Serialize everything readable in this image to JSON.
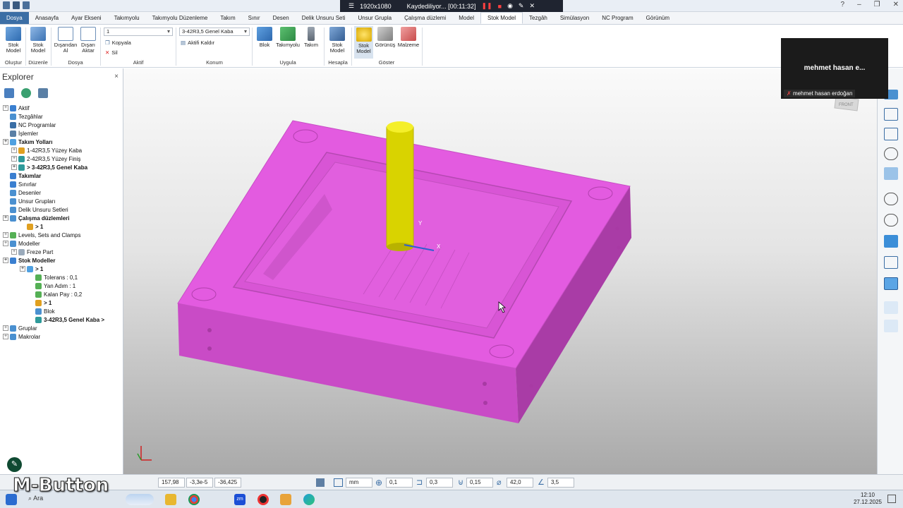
{
  "titlebar": {
    "resolution": "1920x1080",
    "recording": "Kaydediliyor... [00:11:32]"
  },
  "tabs": [
    "Dosya",
    "Anasayfa",
    "Ayar Ekseni",
    "Takımyolu",
    "Takımyolu Düzenleme",
    "Takım",
    "Sınır",
    "Desen",
    "Delik Unsuru Seti",
    "Unsur Grupla",
    "Çalışma düzlemi",
    "Model",
    "Stok Model",
    "Tezgâh",
    "Simülasyon",
    "NC Program",
    "Görünüm"
  ],
  "ribbon": {
    "olustur": {
      "btn": "Stok Model",
      "group": "Oluştur"
    },
    "duzenle": {
      "btn": "Stok Model",
      "group": "Düzenle"
    },
    "dosya": {
      "btn1": "Dışarıdan Al",
      "btn2": "Dışarı Aktar",
      "group": "Dosya"
    },
    "aktif": {
      "combo": "1",
      "kopyala": "Kopyala",
      "sil": "Sil",
      "group": "Aktif"
    },
    "konum": {
      "combo": "3-42R3,5 Genel Kaba",
      "aktifi_kaldir": "Aktifi Kaldır",
      "group": "Konum"
    },
    "uygula": {
      "blok": "Blok",
      "takimyolu": "Takımyolu",
      "takim": "Takım",
      "group": "Uygula"
    },
    "hesapla": {
      "btn": "Stok Model",
      "group": "Hesapla"
    },
    "goster": {
      "stok": "Stok Model",
      "gorunus": "Görünüş",
      "malzeme": "Malzeme",
      "group": "Göster"
    }
  },
  "explorer": {
    "title": "Explorer",
    "items": [
      {
        "label": "Aktif",
        "bold": false,
        "indent": 0
      },
      {
        "label": "Tezgâhlar",
        "bold": false,
        "indent": 0
      },
      {
        "label": "NC Programlar",
        "bold": false,
        "indent": 0
      },
      {
        "label": "İşlemler",
        "bold": false,
        "indent": 0
      },
      {
        "label": "Takım Yolları",
        "bold": true,
        "indent": 0
      },
      {
        "label": "1-42R3,5 Yüzey Kaba",
        "bold": false,
        "indent": 1
      },
      {
        "label": "2-42R3,5 Yüzey Finiş",
        "bold": false,
        "indent": 1
      },
      {
        "label": "> 3-42R3,5 Genel Kaba",
        "bold": true,
        "indent": 1
      },
      {
        "label": "Takımlar",
        "bold": true,
        "indent": 0
      },
      {
        "label": "Sınırlar",
        "bold": false,
        "indent": 0
      },
      {
        "label": "Desenler",
        "bold": false,
        "indent": 0
      },
      {
        "label": "Unsur Grupları",
        "bold": false,
        "indent": 0
      },
      {
        "label": "Delik Unsuru Setleri",
        "bold": false,
        "indent": 0
      },
      {
        "label": "Çalışma düzlemleri",
        "bold": true,
        "indent": 0
      },
      {
        "label": "> 1",
        "bold": true,
        "indent": 2
      },
      {
        "label": "Levels, Sets and Clamps",
        "bold": false,
        "indent": 0
      },
      {
        "label": "Modeller",
        "bold": false,
        "indent": 0
      },
      {
        "label": "Freze Part",
        "bold": false,
        "indent": 1
      },
      {
        "label": "Stok Modeller",
        "bold": true,
        "indent": 0
      },
      {
        "label": "> 1",
        "bold": true,
        "indent": 2
      },
      {
        "label": "Tolerans  :  0,1",
        "bold": false,
        "indent": 3
      },
      {
        "label": "Yan Adım  :  1",
        "bold": false,
        "indent": 3
      },
      {
        "label": "Kalan Pay  :  0,2",
        "bold": false,
        "indent": 3
      },
      {
        "label": "> 1",
        "bold": true,
        "indent": 3
      },
      {
        "label": "Blok",
        "bold": false,
        "indent": 3
      },
      {
        "label": "3-42R3,5 Genel Kaba >",
        "bold": true,
        "indent": 3
      },
      {
        "label": "Gruplar",
        "bold": false,
        "indent": 0
      },
      {
        "label": "Makrolar",
        "bold": false,
        "indent": 0
      }
    ]
  },
  "zoom": {
    "name_short": "mehmet hasan e...",
    "name_full": "mehmet hasan erdoğan"
  },
  "viewport": {
    "axis_y": "Y",
    "axis_x": "X",
    "front": "FRONT"
  },
  "status": {
    "x": "157,98",
    "y": "-3,3e-5",
    "z": "-36,425",
    "unit": "mm",
    "tol": "0,1",
    "thick": "0,3",
    "step": "0,15",
    "diam": "42,0",
    "rad": "3,5"
  },
  "taskbar": {
    "search": "Ara",
    "time": "12:10",
    "date": "27.12.2025"
  },
  "watermark": "M-Button",
  "colors": {
    "stock": "#e35be0",
    "tool": "#d9d300",
    "ribbon_accent": "#3b6ea5"
  }
}
